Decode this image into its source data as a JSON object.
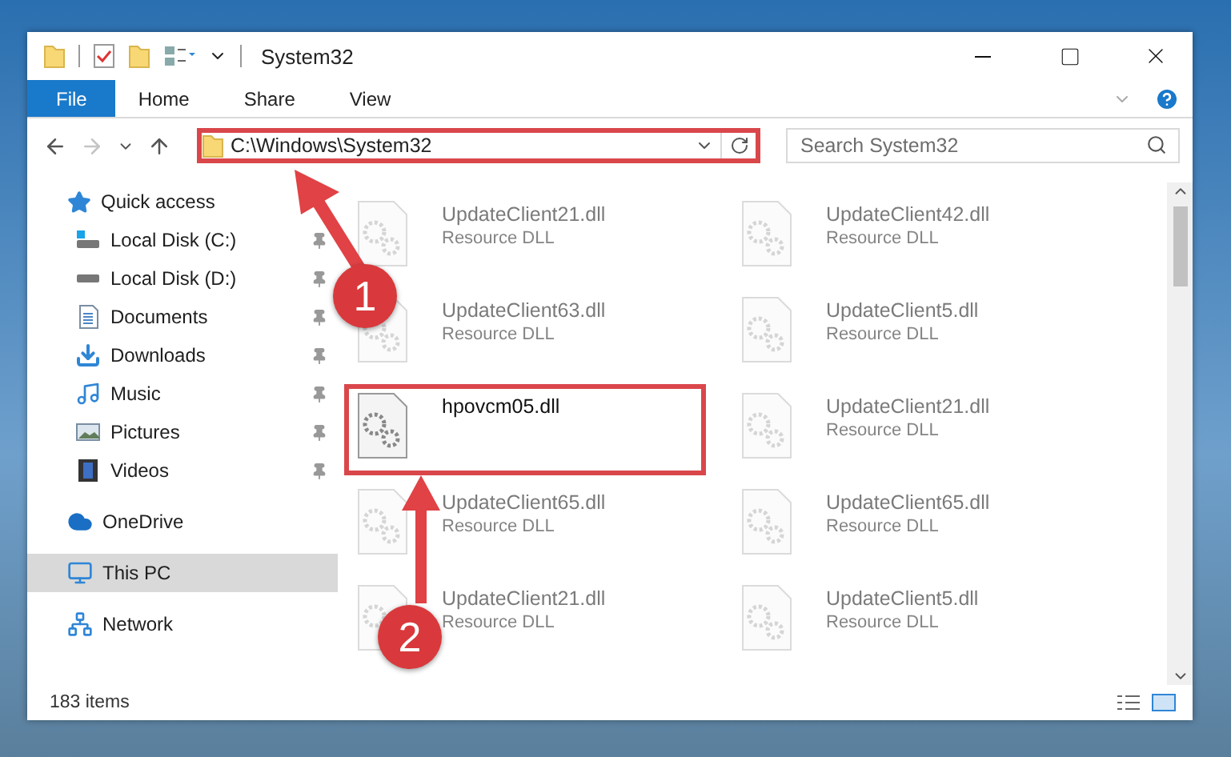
{
  "window": {
    "title": "System32"
  },
  "ribbon_tabs": [
    {
      "label": "File",
      "kind": "file",
      "selected": false
    },
    {
      "label": "Home",
      "kind": "tab",
      "selected": false
    },
    {
      "label": "Share",
      "kind": "tab",
      "selected": false
    },
    {
      "label": "View",
      "kind": "tab",
      "selected": false
    }
  ],
  "address": {
    "path": "C:\\Windows\\System32",
    "highlighted": true
  },
  "search": {
    "placeholder": "Search System32"
  },
  "sidebar": {
    "items": [
      {
        "label": "Quick access",
        "kind": "star",
        "selected": false,
        "children": [
          {
            "label": "Local Disk (C:)",
            "kind": "windrive",
            "pinned": true,
            "selected": false
          },
          {
            "label": "Local Disk (D:)",
            "kind": "drive",
            "pinned": true,
            "selected": false
          },
          {
            "label": "Documents",
            "kind": "docs",
            "pinned": true,
            "selected": false
          },
          {
            "label": "Downloads",
            "kind": "download",
            "pinned": true,
            "selected": false
          },
          {
            "label": "Music",
            "kind": "music",
            "pinned": true,
            "selected": false
          },
          {
            "label": "Pictures",
            "kind": "pictures",
            "pinned": true,
            "selected": false
          },
          {
            "label": "Videos",
            "kind": "videos",
            "pinned": true,
            "selected": false
          }
        ]
      },
      {
        "label": "OneDrive",
        "kind": "cloud",
        "selected": false
      },
      {
        "label": "This PC",
        "kind": "pc",
        "selected": true
      },
      {
        "label": "Network",
        "kind": "network",
        "selected": false
      }
    ]
  },
  "files": [
    {
      "name": "UpdateClient21.dll",
      "type": "Resource DLL",
      "faded": true,
      "highlighted": false
    },
    {
      "name": "UpdateClient42.dll",
      "type": "Resource DLL",
      "faded": true,
      "highlighted": false
    },
    {
      "name": "UpdateClient63.dll",
      "type": "Resource DLL",
      "faded": true,
      "highlighted": false
    },
    {
      "name": "UpdateClient5.dll",
      "type": "Resource DLL",
      "faded": true,
      "highlighted": false
    },
    {
      "name": "hpovcm05.dll",
      "faded": false,
      "highlighted": true
    },
    {
      "name": "UpdateClient21.dll",
      "type": "Resource DLL",
      "faded": true,
      "highlighted": false
    },
    {
      "name": "UpdateClient65.dll",
      "type": "Resource DLL",
      "faded": true,
      "highlighted": false
    },
    {
      "name": "UpdateClient65.dll",
      "type": "Resource DLL",
      "faded": true,
      "highlighted": false
    },
    {
      "name": "UpdateClient21.dll",
      "type": "Resource DLL",
      "faded": true,
      "highlighted": false
    },
    {
      "name": "UpdateClient5.dll",
      "type": "Resource DLL",
      "faded": true,
      "highlighted": false
    }
  ],
  "status_bar": {
    "count": "183 items"
  },
  "callouts": [
    {
      "number": "1"
    },
    {
      "number": "2"
    }
  ]
}
